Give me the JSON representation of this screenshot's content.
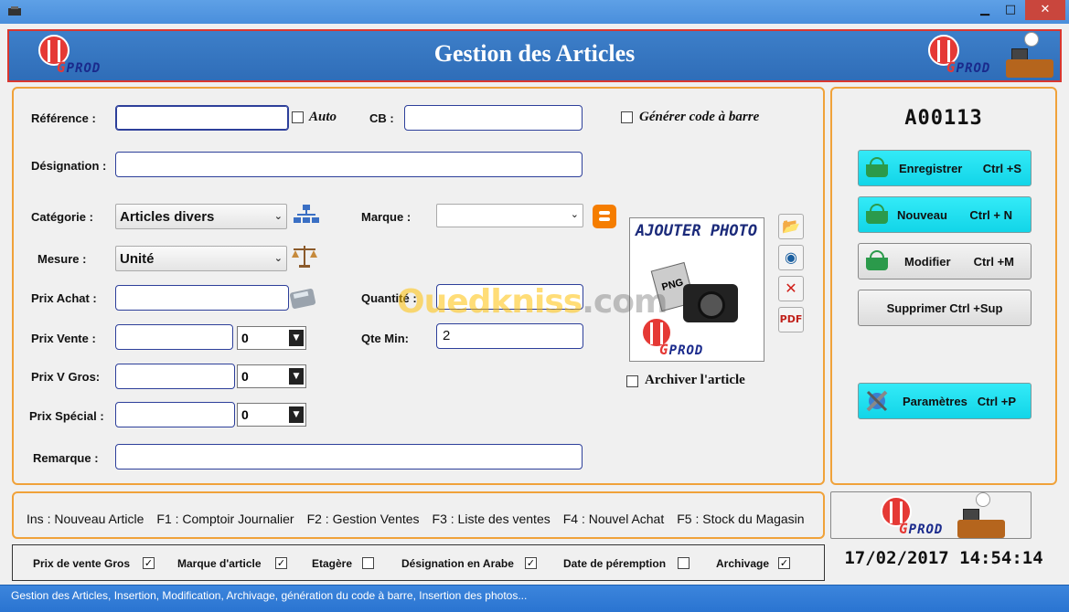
{
  "window": {
    "minimize": "▁",
    "maximize": "□",
    "close": "✕"
  },
  "header": {
    "title": "Gestion des Articles",
    "logo_text_prefix": "G",
    "logo_text": "PROD"
  },
  "form": {
    "reference_label": "Référence :",
    "reference_value": "",
    "auto_label": "Auto",
    "auto_checked": false,
    "cb_label": "CB :",
    "cb_value": "",
    "generate_barcode_label": "Générer code à barre",
    "generate_barcode_checked": false,
    "designation_label": "Désignation :",
    "designation_value": "",
    "categorie_label": "Catégorie :",
    "categorie_value": "Articles divers",
    "marque_label": "Marque :",
    "marque_value": "",
    "mesure_label": "Mesure :",
    "mesure_value": "Unité",
    "prix_achat_label": "Prix Achat :",
    "prix_achat_value": "",
    "quantite_label": "Quantité :",
    "quantite_value": "",
    "prix_vente_label": "Prix Vente :",
    "prix_vente_value": "",
    "prix_vente_select": "0",
    "qte_min_label": "Qte Min:",
    "qte_min_value": "2",
    "prix_v_gros_label": "Prix V Gros:",
    "prix_v_gros_value": "",
    "prix_v_gros_select": "0",
    "prix_special_label": "Prix Spécial :",
    "prix_special_value": "",
    "prix_special_select": "0",
    "remarque_label": "Remarque :",
    "remarque_value": "",
    "archiver_label": "Archiver l'article",
    "archiver_checked": false
  },
  "photo": {
    "title": "AJOUTER PHOTO",
    "png_text": "PNG"
  },
  "watermark": {
    "brand": "Ouedkniss",
    "suffix": ".com"
  },
  "side": {
    "code": "A00113",
    "enregistrer": {
      "label": "Enregistrer",
      "shortcut": "Ctrl +S"
    },
    "nouveau": {
      "label": "Nouveau",
      "shortcut": "Ctrl + N"
    },
    "modifier": {
      "label": "Modifier",
      "shortcut": "Ctrl +M"
    },
    "supprimer": {
      "label": "Supprimer  Ctrl +Sup"
    },
    "parametres": {
      "label": "Paramètres",
      "shortcut": "Ctrl +P"
    }
  },
  "shortcuts": [
    "Ins : Nouveau Article",
    "F1 : Comptoir Journalier",
    "F2 : Gestion Ventes",
    "F3 : Liste des ventes",
    "F4 : Nouvel Achat",
    "F5 : Stock du Magasin"
  ],
  "options": [
    {
      "label": "Prix de vente Gros",
      "checked": "✓"
    },
    {
      "label": "Marque d'article",
      "checked": "✓"
    },
    {
      "label": "Etagère",
      "checked": ""
    },
    {
      "label": "Désignation en Arabe",
      "checked": "✓"
    },
    {
      "label": "Date de péremption",
      "checked": ""
    },
    {
      "label": "Archivage",
      "checked": "✓"
    }
  ],
  "datetime": "17/02/2017 14:54:14",
  "status": "Gestion des Articles, Insertion, Modification, Archivage, génération du code à barre, Insertion des photos..."
}
